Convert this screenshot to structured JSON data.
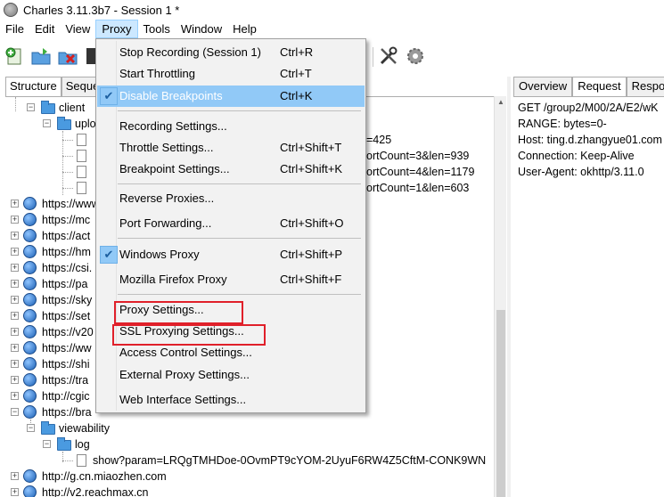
{
  "window": {
    "title": "Charles 3.11.3b7 - Session 1 *"
  },
  "menubar": [
    "File",
    "Edit",
    "View",
    "Proxy",
    "Tools",
    "Window",
    "Help"
  ],
  "toolbar": {
    "icons": [
      "new-session-icon",
      "open-icon",
      "close-session-icon",
      "save-icon",
      "tools-icon",
      "settings-gear-icon"
    ]
  },
  "left_tabs": [
    "Structure",
    "Seque"
  ],
  "tree": {
    "client": "client",
    "uplo": "uplo",
    "partials": [
      "=425",
      "ortCount=3&len=939",
      "ortCount=4&len=1179",
      "ortCount=1&len=603"
    ],
    "hosts": [
      "https://www",
      "https://mc",
      "https://act",
      "https://hm",
      "https://csi.",
      "https://pa",
      "https://sky",
      "https://set",
      "https://v20",
      "https://ww",
      "https://shi",
      "https://tra",
      "http://cgic",
      "https://bra"
    ],
    "viewability": "viewability",
    "log": "log",
    "show": "show?param=LRQgTMHDoe-0OvmPT9cYOM-2UyuF6RW4Z5CftM-CONK9WN",
    "host_after_1": "http://g.cn.miaozhen.com",
    "host_after_2": "http://v2.reachmax.cn"
  },
  "right_tabs": [
    "Overview",
    "Request",
    "Respor"
  ],
  "request_lines": [
    "GET /group2/M00/2A/E2/wK",
    "RANGE: bytes=0-",
    "Host: ting.d.zhangyue01.com",
    "Connection: Keep-Alive",
    "User-Agent: okhttp/3.11.0"
  ],
  "proxy_menu": {
    "stop_recording": {
      "label": "Stop Recording (Session 1)",
      "shortcut": "Ctrl+R"
    },
    "start_throttling": {
      "label": "Start Throttling",
      "shortcut": "Ctrl+T"
    },
    "disable_breakpoints": {
      "label": "Disable Breakpoints",
      "shortcut": "Ctrl+K"
    },
    "recording_settings": {
      "label": "Recording Settings...",
      "shortcut": ""
    },
    "throttle_settings": {
      "label": "Throttle Settings...",
      "shortcut": "Ctrl+Shift+T"
    },
    "breakpoint_settings": {
      "label": "Breakpoint Settings...",
      "shortcut": "Ctrl+Shift+K"
    },
    "reverse_proxies": {
      "label": "Reverse Proxies...",
      "shortcut": ""
    },
    "port_forwarding": {
      "label": "Port Forwarding...",
      "shortcut": "Ctrl+Shift+O"
    },
    "windows_proxy": {
      "label": "Windows Proxy",
      "shortcut": "Ctrl+Shift+P"
    },
    "mozilla_firefox_proxy": {
      "label": "Mozilla Firefox Proxy",
      "shortcut": "Ctrl+Shift+F"
    },
    "proxy_settings": {
      "label": "Proxy Settings...",
      "shortcut": ""
    },
    "ssl_proxying_settings": {
      "label": "SSL Proxying Settings...",
      "shortcut": ""
    },
    "access_control_settings": {
      "label": "Access Control Settings...",
      "shortcut": ""
    },
    "external_proxy_settings": {
      "label": "External Proxy Settings...",
      "shortcut": ""
    },
    "web_interface_settings": {
      "label": "Web Interface Settings...",
      "shortcut": ""
    }
  },
  "colors": {
    "menu_highlight": "#91c9f7",
    "annotation_red": "#e0202a",
    "active_menu": "#cce8ff"
  }
}
